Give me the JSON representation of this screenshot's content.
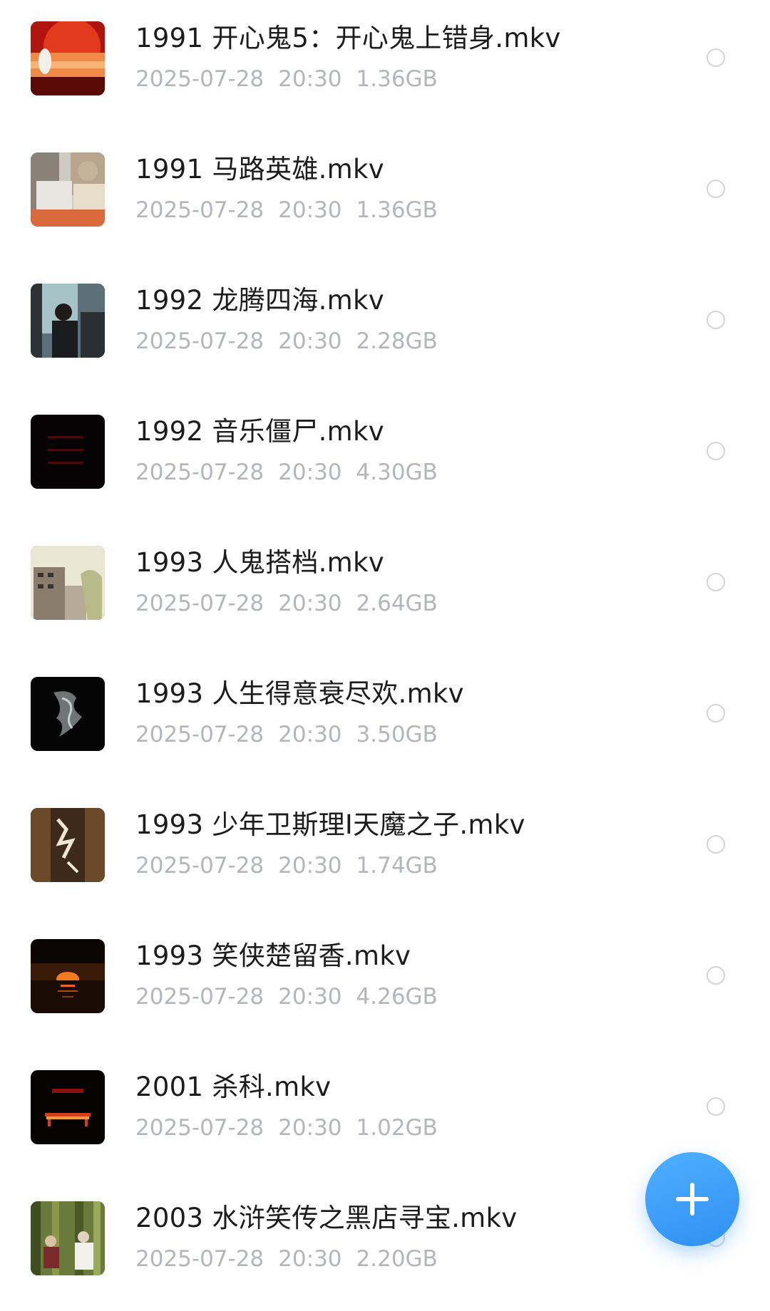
{
  "files": [
    {
      "name": "1991 开心鬼5：开心鬼上错身.mkv",
      "date": "2025-07-28",
      "time": "20:30",
      "size": "1.36GB",
      "icon": "video-thumbnail"
    },
    {
      "name": "1991 马路英雄.mkv",
      "date": "2025-07-28",
      "time": "20:30",
      "size": "1.36GB",
      "icon": "video-thumbnail"
    },
    {
      "name": "1992 龙腾四海.mkv",
      "date": "2025-07-28",
      "time": "20:30",
      "size": "2.28GB",
      "icon": "video-thumbnail"
    },
    {
      "name": "1992 音乐僵尸.mkv",
      "date": "2025-07-28",
      "time": "20:30",
      "size": "4.30GB",
      "icon": "video-thumbnail"
    },
    {
      "name": "1993 人鬼搭档.mkv",
      "date": "2025-07-28",
      "time": "20:30",
      "size": "2.64GB",
      "icon": "video-thumbnail"
    },
    {
      "name": "1993 人生得意衰尽欢.mkv",
      "date": "2025-07-28",
      "time": "20:30",
      "size": "3.50GB",
      "icon": "video-thumbnail"
    },
    {
      "name": "1993 少年卫斯理I天魔之子.mkv",
      "date": "2025-07-28",
      "time": "20:30",
      "size": "1.74GB",
      "icon": "video-thumbnail"
    },
    {
      "name": "1993 笑侠楚留香.mkv",
      "date": "2025-07-28",
      "time": "20:30",
      "size": "4.26GB",
      "icon": "video-thumbnail"
    },
    {
      "name": "2001 杀科.mkv",
      "date": "2025-07-28",
      "time": "20:30",
      "size": "1.02GB",
      "icon": "video-thumbnail"
    },
    {
      "name": "2003 水浒笑传之黑店寻宝.mkv",
      "date": "2025-07-28",
      "time": "20:30",
      "size": "2.20GB",
      "icon": "video-thumbnail"
    }
  ],
  "fab": {
    "icon": "plus-icon",
    "color": "#3a9af5"
  },
  "colors": {
    "name_text": "#1c1c1c",
    "meta_text": "#b3b6bb",
    "radio_border": "#d2d4d8"
  }
}
